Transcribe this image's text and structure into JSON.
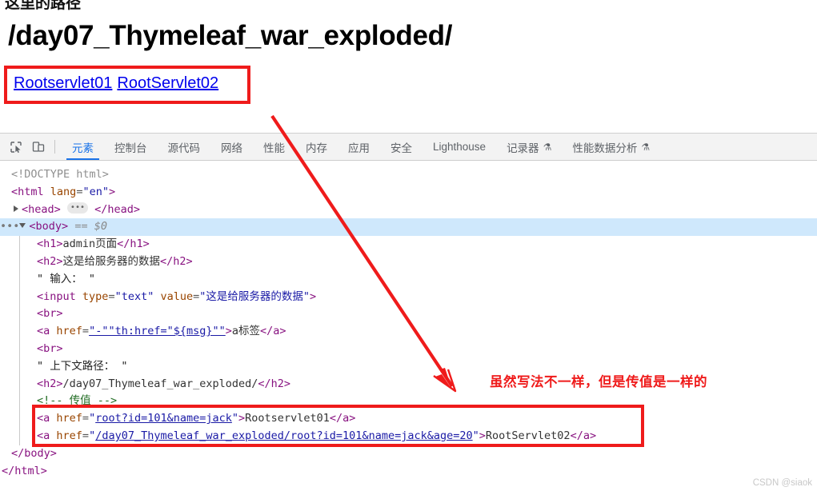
{
  "page": {
    "clipped_top_text": "这里的路径",
    "heading": "/day07_Thymeleaf_war_exploded/",
    "links": [
      {
        "label": "Rootservlet01"
      },
      {
        "label": "RootServlet02"
      }
    ]
  },
  "annotations": {
    "note_text": "虽然写法不一样，但是传值是一样的",
    "accent_color": "#ef1b1b"
  },
  "devtools": {
    "icons": [
      {
        "name": "inspect-element-icon"
      },
      {
        "name": "device-toolbar-icon"
      }
    ],
    "tabs": [
      {
        "label": "元素",
        "active": true,
        "beaker": false
      },
      {
        "label": "控制台",
        "active": false,
        "beaker": false
      },
      {
        "label": "源代码",
        "active": false,
        "beaker": false
      },
      {
        "label": "网络",
        "active": false,
        "beaker": false
      },
      {
        "label": "性能",
        "active": false,
        "beaker": false
      },
      {
        "label": "内存",
        "active": false,
        "beaker": false
      },
      {
        "label": "应用",
        "active": false,
        "beaker": false
      },
      {
        "label": "安全",
        "active": false,
        "beaker": false
      },
      {
        "label": "Lighthouse",
        "active": false,
        "beaker": false
      },
      {
        "label": "记录器",
        "active": false,
        "beaker": true
      },
      {
        "label": "性能数据分析",
        "active": false,
        "beaker": true
      }
    ],
    "beaker_glyph": "⚗",
    "dom": {
      "doctype": "<!DOCTYPE html>",
      "html_open_lt": "<",
      "html_tag": "html",
      "html_attr_name": "lang",
      "html_attr_value": "\"en\"",
      "html_open_gt": ">",
      "head_open": "<head>",
      "head_close": "</head>",
      "body_open": "<body>",
      "body_selected_marker": "== $0",
      "body_close": "</body>",
      "html_close": "</html>",
      "h1_open": "<h1>",
      "h1_text": "admin页面",
      "h1_close": "</h1>",
      "h2a_open": "<h2>",
      "h2a_text": "这是给服务器的数据",
      "h2a_close": "</h2>",
      "text_input_label": "\" 输入： \"",
      "input_open": "<input",
      "input_attr1_name": "type",
      "input_attr1_value": "\"text\"",
      "input_attr2_name": "value",
      "input_attr2_value": "\"这是给服务器的数据\"",
      "input_close": ">",
      "br1": "<br>",
      "a_msg_open": "<a",
      "a_msg_attr_name": "href",
      "a_msg_attr_value": "\"-\"\"th:href=\"${msg}\"\"",
      "a_msg_gt": ">",
      "a_msg_text": "a标签",
      "a_msg_close": "</a>",
      "br2": "<br>",
      "text_ctx_label": "\" 上下文路径： \"",
      "h2b_open": "<h2>",
      "h2b_text": "/day07_Thymeleaf_war_exploded/",
      "h2b_close": "</h2>",
      "comment": "<!-- 传值 -->",
      "a1_open": "<a",
      "a1_attr_name": "href",
      "a1_attr_value": "root?id=101&name=jack",
      "a1_gt": ">",
      "a1_text": "Rootservlet01",
      "a1_close": "</a>",
      "a2_open": "<a",
      "a2_attr_name": "href",
      "a2_attr_value": "/day07_Thymeleaf_war_exploded/root?id=101&name=jack&age=20",
      "a2_gt": ">",
      "a2_text": "RootServlet02",
      "a2_close": "</a>"
    }
  },
  "watermark": "CSDN @siaok"
}
